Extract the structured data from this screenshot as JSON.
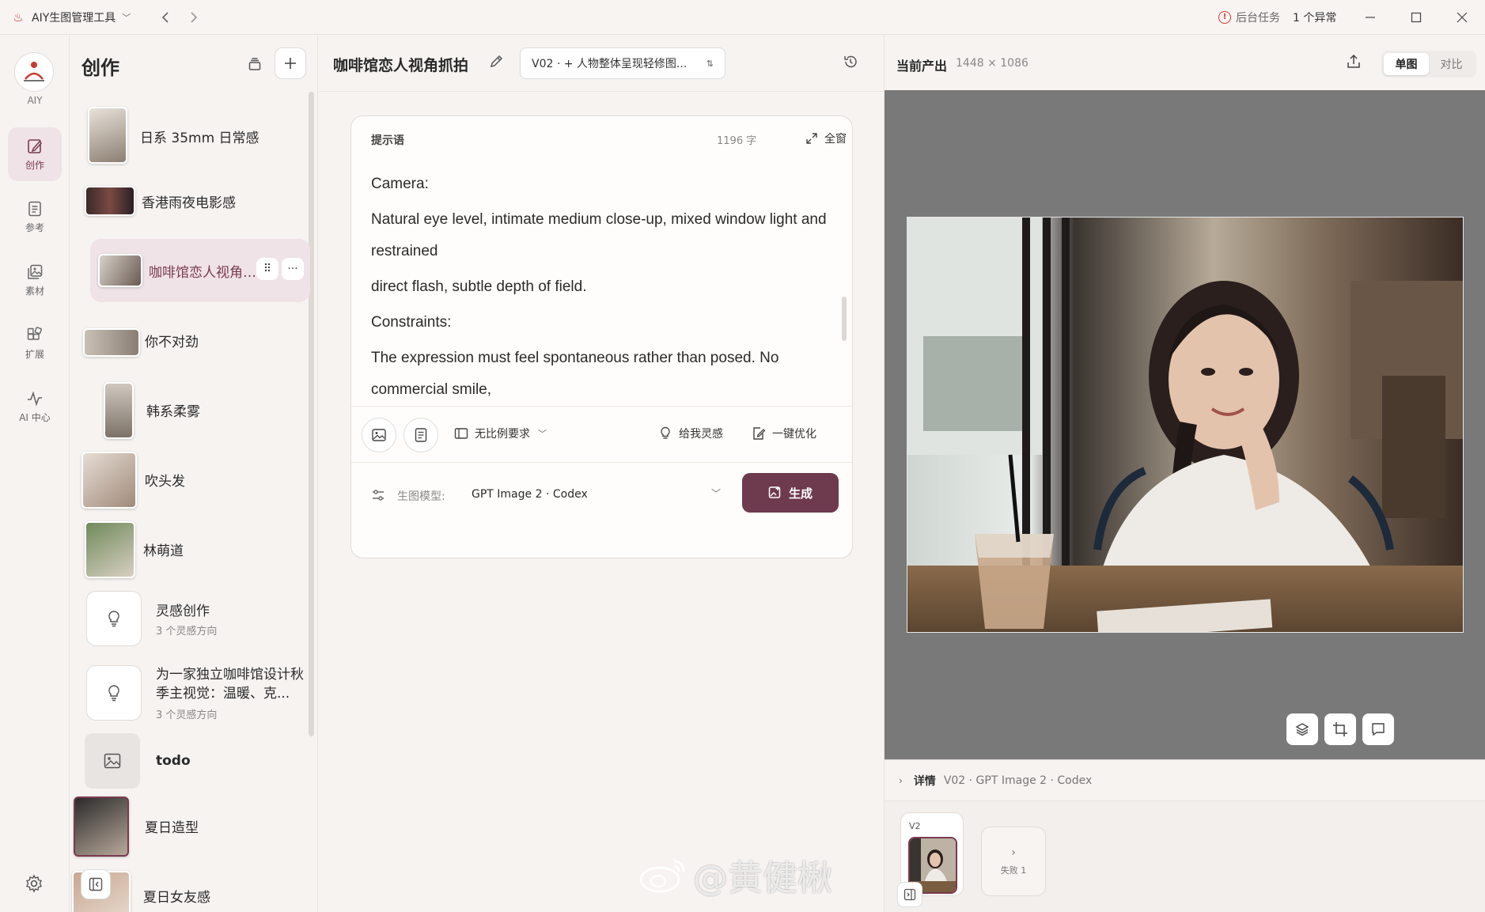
{
  "app": {
    "title": "AIY生图管理工具",
    "task_label": "后台任务",
    "task_count": "1 个异常"
  },
  "rail": {
    "avatar_label": "AIY",
    "items": [
      {
        "label": "创作",
        "icon": "pencil-icon",
        "active": true
      },
      {
        "label": "参考",
        "icon": "document-icon",
        "active": false
      },
      {
        "label": "素材",
        "icon": "images-icon",
        "active": false
      },
      {
        "label": "扩展",
        "icon": "puzzle-icon",
        "active": false
      },
      {
        "label": "AI 中心",
        "icon": "pulse-icon",
        "active": false
      }
    ]
  },
  "list": {
    "title": "创作",
    "items": [
      {
        "name": "日系 35mm 日常感"
      },
      {
        "name": "香港雨夜电影感"
      },
      {
        "name": "咖啡馆恋人视角抓拍",
        "active": true
      },
      {
        "name": "你不对劲"
      },
      {
        "name": "韩系柔雾"
      },
      {
        "name": "吹头发"
      },
      {
        "name": "林萌道"
      },
      {
        "name": "灵感创作",
        "sub": "3 个灵感方向"
      },
      {
        "name": "为一家独立咖啡馆设计秋季主视觉：温暖、克...",
        "sub": "3 个灵感方向"
      },
      {
        "name": "todo"
      },
      {
        "name": "夏日造型"
      },
      {
        "name": "夏日女友感"
      }
    ]
  },
  "editor": {
    "project_title": "咖啡馆恋人视角抓拍",
    "version_label": "V02 · + 人物整体呈现轻修图...",
    "prompt_label": "提示语",
    "char_count": "1196 字",
    "fullscreen_label": "全窗",
    "prompt_paragraphs": [
      "Camera:",
      "Natural eye level, intimate medium close-up, mixed window light and restrained",
      "direct flash, subtle depth of field.",
      "Constraints:",
      "The expression must feel spontaneous rather than posed. No commercial smile,"
    ],
    "ratio_label": "无比例要求",
    "inspire_label": "给我灵感",
    "optimize_label": "一键优化",
    "model_label": "生图模型:",
    "model_value": "GPT Image 2 · Codex",
    "generate_label": "生成"
  },
  "preview": {
    "title": "当前产出",
    "dims": "1448 × 1086",
    "toggle_single": "单图",
    "toggle_compare": "对比",
    "details_label": "详情",
    "details_meta": "V02 · GPT Image 2 · Codex",
    "version_card_label": "V2",
    "fail_label": "失败 1"
  },
  "watermark": "@黄健楸",
  "colors": {
    "accent": "#6e3a4e",
    "active_bg": "#efe3e7",
    "canvas_bg": "#797979",
    "warning": "#dd3333"
  }
}
